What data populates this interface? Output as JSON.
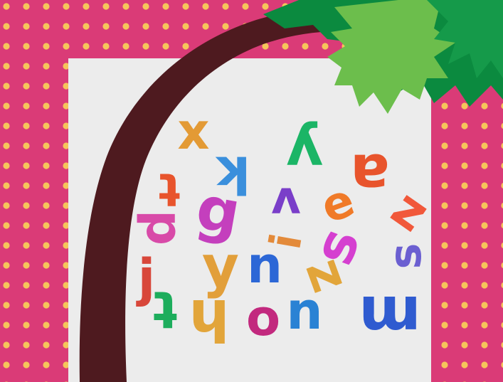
{
  "scene": {
    "description_colors": {
      "frame": "#da3b77",
      "dots": "#f6c55a",
      "panel": "#ececec",
      "trunk": "#4e1a1f",
      "leaf_dark": "#0b8a3f",
      "leaf_mid": "#159a4a",
      "leaf_light": "#6cbe4c"
    },
    "letters": [
      {
        "id": "x",
        "char": "x",
        "color": "#e39a35",
        "rot": 0
      },
      {
        "id": "t1",
        "char": "t",
        "color": "#e8542c",
        "rot": 180
      },
      {
        "id": "k",
        "char": "k",
        "color": "#3a8fdc",
        "rot": 180
      },
      {
        "id": "v",
        "char": "v",
        "color": "#7a3ec9",
        "rot": 180
      },
      {
        "id": "y1",
        "char": "y",
        "color": "#1bb566",
        "rot": 180
      },
      {
        "id": "a1",
        "char": "a",
        "color": "#e8542c",
        "rot": 180
      },
      {
        "id": "e",
        "char": "e",
        "color": "#f07a28",
        "rot": -20
      },
      {
        "id": "z1",
        "char": "z",
        "color": "#f1583a",
        "rot": 35
      },
      {
        "id": "p",
        "char": "p",
        "color": "#d84aa8",
        "rot": 90
      },
      {
        "id": "g",
        "char": "g",
        "color": "#c43fbd",
        "rot": 10
      },
      {
        "id": "i1",
        "char": "i",
        "color": "#e38a3a",
        "rot": -80
      },
      {
        "id": "s",
        "char": "s",
        "color": "#d53fd0",
        "rot": -70
      },
      {
        "id": "sl",
        "char": "s",
        "color": "#6b5fd1",
        "rot": -90
      },
      {
        "id": "j",
        "char": "j",
        "color": "#d8473a",
        "rot": 0
      },
      {
        "id": "y2",
        "char": "y",
        "color": "#e29f3a",
        "rot": 0
      },
      {
        "id": "n",
        "char": "n",
        "color": "#2c67d6",
        "rot": 0
      },
      {
        "id": "z2",
        "char": "z",
        "color": "#e2a53a",
        "rot": 70
      },
      {
        "id": "m",
        "char": "m",
        "color": "#2f5bd0",
        "rot": 180
      },
      {
        "id": "t2",
        "char": "t",
        "color": "#1dad5c",
        "rot": 180
      },
      {
        "id": "h",
        "char": "h",
        "color": "#e2a53a",
        "rot": 180
      },
      {
        "id": "o",
        "char": "o",
        "color": "#c2297e",
        "rot": 0
      },
      {
        "id": "u",
        "char": "u",
        "color": "#2a82d4",
        "rot": 180
      }
    ]
  }
}
